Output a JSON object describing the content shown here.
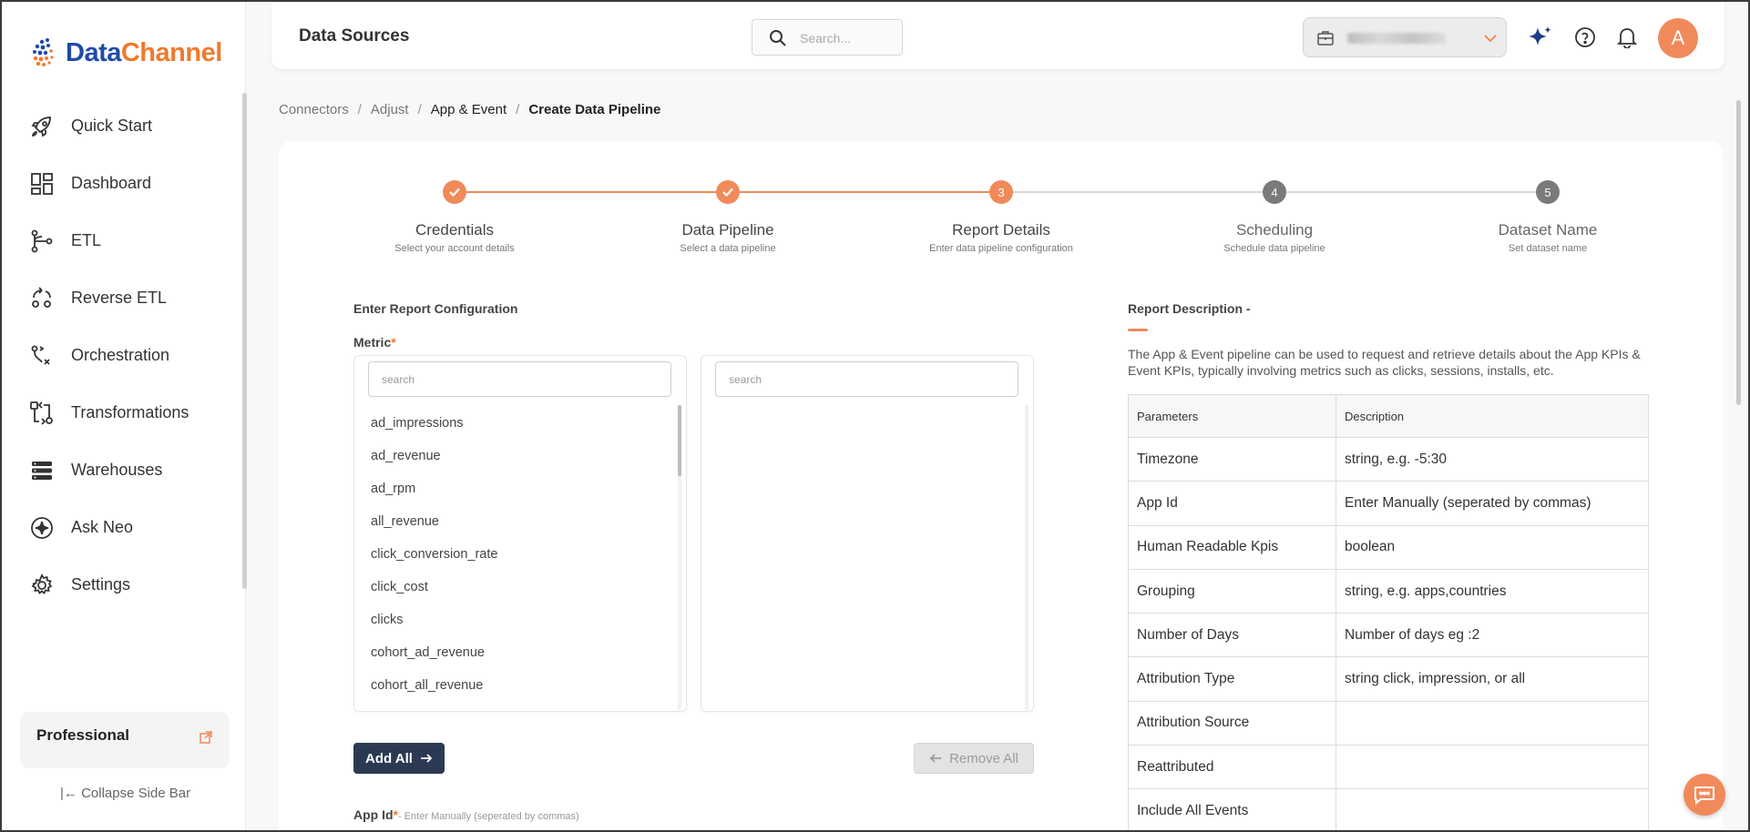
{
  "brand": {
    "name_part1": "Data",
    "name_part2": "Channel"
  },
  "sidebar": {
    "items": [
      {
        "label": "Quick Start",
        "icon": "rocket-icon"
      },
      {
        "label": "Dashboard",
        "icon": "dashboard-icon"
      },
      {
        "label": "ETL",
        "icon": "etl-icon"
      },
      {
        "label": "Reverse ETL",
        "icon": "reverse-etl-icon"
      },
      {
        "label": "Orchestration",
        "icon": "orchestration-icon"
      },
      {
        "label": "Transformations",
        "icon": "transformations-icon"
      },
      {
        "label": "Warehouses",
        "icon": "warehouses-icon"
      },
      {
        "label": "Ask Neo",
        "icon": "ask-neo-icon"
      },
      {
        "label": "Settings",
        "icon": "gear-icon"
      }
    ],
    "plan": "Professional",
    "collapse_label": "Collapse Side Bar"
  },
  "header": {
    "title": "Data Sources",
    "search_placeholder": "Search...",
    "avatar_initial": "A"
  },
  "breadcrumb": [
    "Connectors",
    "Adjust",
    "App & Event",
    "Create Data Pipeline"
  ],
  "stepper": {
    "steps": [
      {
        "number": "1",
        "label": "Credentials",
        "sub": "Select your account details",
        "state": "done"
      },
      {
        "number": "2",
        "label": "Data Pipeline",
        "sub": "Select a data pipeline",
        "state": "done"
      },
      {
        "number": "3",
        "label": "Report Details",
        "sub": "Enter data pipeline configuration",
        "state": "active"
      },
      {
        "number": "4",
        "label": "Scheduling",
        "sub": "Schedule data pipeline",
        "state": "pending"
      },
      {
        "number": "5",
        "label": "Dataset Name",
        "sub": "Set dataset name",
        "state": "pending"
      }
    ]
  },
  "config": {
    "section_title": "Enter Report Configuration",
    "metric_label": "Metric",
    "required_mark": "*",
    "left_search_placeholder": "search",
    "right_search_placeholder": "search",
    "metrics": [
      "ad_impressions",
      "ad_revenue",
      "ad_rpm",
      "all_revenue",
      "click_conversion_rate",
      "click_cost",
      "clicks",
      "cohort_ad_revenue",
      "cohort_all_revenue"
    ],
    "add_all_label": "Add All",
    "remove_all_label": "Remove All",
    "app_id_label": "App Id",
    "app_id_hint": "- Enter Manually (seperated by commas)"
  },
  "report": {
    "title": "Report Description -",
    "description": "The App & Event pipeline can be used to request and retrieve details about the App KPIs & Event KPIs, typically involving metrics such as clicks, sessions, installs, etc.",
    "columns": [
      "Parameters",
      "Description"
    ],
    "rows": [
      [
        "Timezone",
        "string, e.g. -5:30"
      ],
      [
        "App Id",
        "Enter Manually (seperated by commas)"
      ],
      [
        "Human Readable Kpis",
        "boolean"
      ],
      [
        "Grouping",
        "string, e.g. apps,countries"
      ],
      [
        "Number of Days",
        "Number of days eg :2"
      ],
      [
        "Attribution Type",
        "string click, impression, or all"
      ],
      [
        "Attribution Source",
        ""
      ],
      [
        "Reattributed",
        ""
      ],
      [
        "Include All Events",
        ""
      ]
    ]
  },
  "colors": {
    "accent": "#f18a5b",
    "brand_blue": "#1f4aa8",
    "dark_button": "#2b3a52",
    "pending_step": "#7a7a7a"
  }
}
